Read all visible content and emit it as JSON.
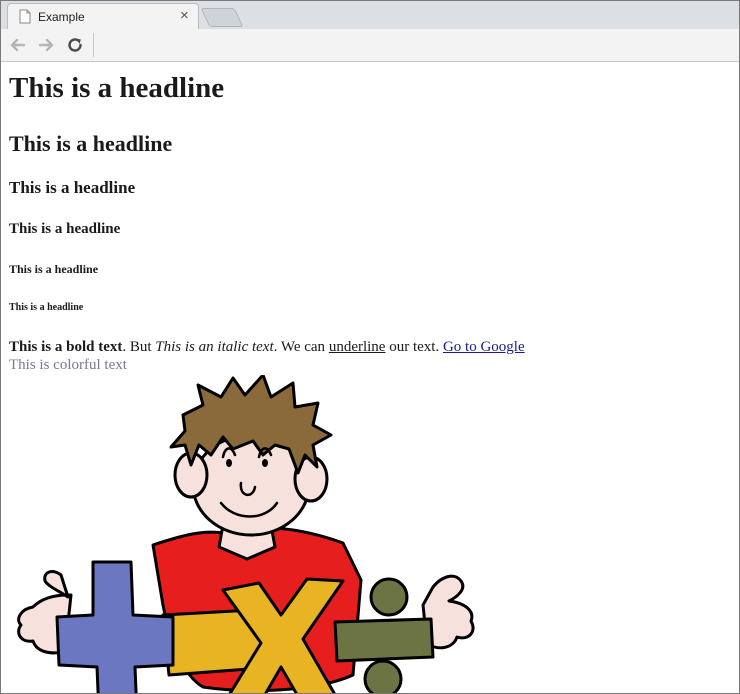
{
  "browser": {
    "tab_title": "Example",
    "close_glyph": "×"
  },
  "page": {
    "h1": "This is a headline",
    "h2": "This is a headline",
    "h3": "This is a headline",
    "h4": "This is a headline",
    "h5": "This is a headline",
    "h6": "This is a headline",
    "bold_text": "This is a bold text",
    "after_bold": ". But ",
    "italic_text": "This is an italic text",
    "after_italic": ". We can ",
    "underline_text": "underline",
    "after_underline": " our text. ",
    "link_text": "Go to Google ",
    "colorful_text": "This is colorful text",
    "colorful_color": "#7a7a8e"
  },
  "clipart": {
    "plus_color": "#6b77c0",
    "minus_color": "#e8b423",
    "times_color": "#e8b423",
    "divide_color": "#6b7442",
    "shirt_color": "#e61e1e",
    "hair_color": "#8a6a3a",
    "skin_color": "#f7e1dc"
  }
}
